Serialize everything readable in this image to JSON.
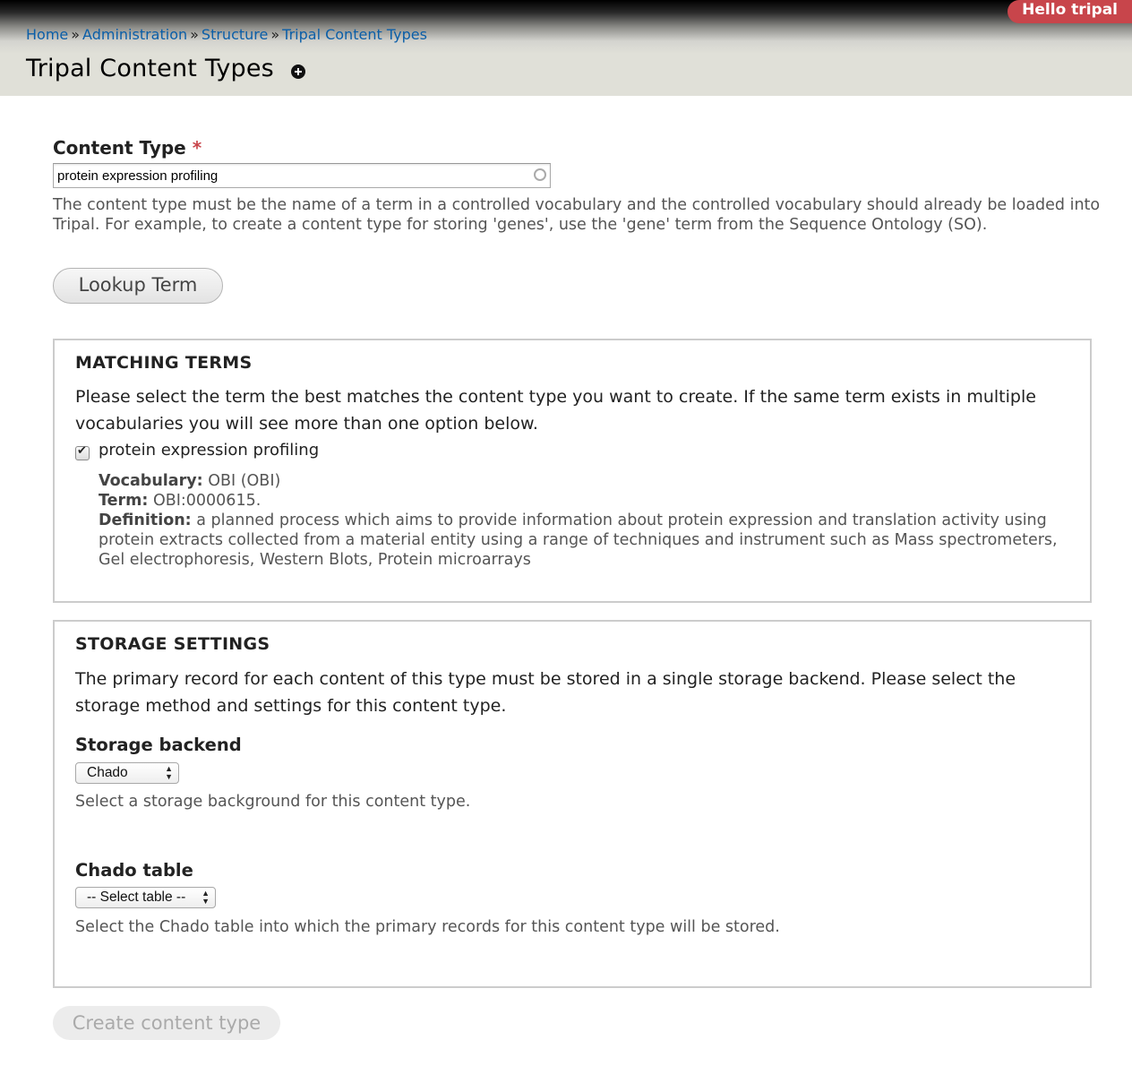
{
  "header": {
    "user_badge": "Hello tripal",
    "breadcrumb": [
      "Home",
      "Administration",
      "Structure",
      "Tripal Content Types"
    ],
    "breadcrumb_sep": "»",
    "title": "Tripal Content Types"
  },
  "content_type": {
    "label": "Content Type",
    "required_mark": "*",
    "value": "protein expression profiling",
    "description_line1": "The content type must be the name of a term in a controlled vocabulary and the controlled vocabulary should already be loaded into",
    "description_line2": "Tripal. For example, to create a content type for storing 'genes', use the 'gene' term from the Sequence Ontology (SO)."
  },
  "lookup_button": "Lookup Term",
  "matching_terms": {
    "legend": "MATCHING TERMS",
    "intro": "Please select the term the best matches the content type you want to create. If the same term exists in multiple vocabularies you will see more than one option below.",
    "option_label": "protein expression profiling",
    "option_checked": true,
    "vocabulary_label": "Vocabulary:",
    "vocabulary_value": "OBI (OBI)",
    "term_label": "Term:",
    "term_value": "OBI:0000615.",
    "definition_label": "Definition:",
    "definition_value": "a planned process which aims to provide information about protein expression and translation activity using protein extracts collected from a material entity using a range of techniques and instrument such as Mass spectrometers, Gel electrophoresis, Western Blots, Protein microarrays"
  },
  "storage_settings": {
    "legend": "STORAGE SETTINGS",
    "intro": "The primary record for each content of this type must be stored in a single storage backend. Please select the storage method and settings for this content type.",
    "backend_label": "Storage backend",
    "backend_value": "Chado",
    "backend_description": "Select a storage background for this content type.",
    "table_label": "Chado table",
    "table_value": "-- Select table --",
    "table_description": "Select the Chado table into which the primary records for this content type will be stored."
  },
  "create_button": "Create content type",
  "colors": {
    "badge": "#c8454b",
    "link": "#0a5ea8",
    "header_bg": "#e0e0d8"
  }
}
